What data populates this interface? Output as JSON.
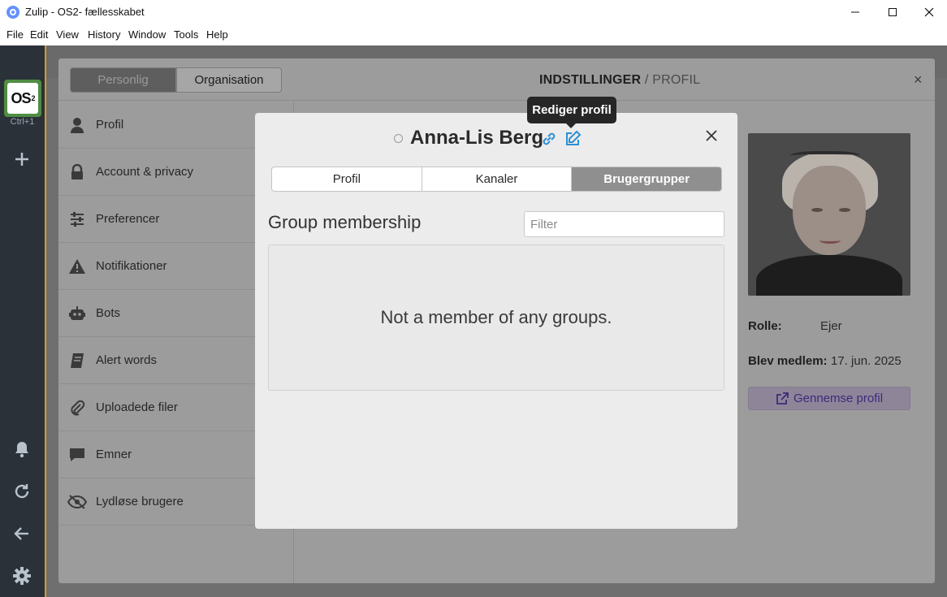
{
  "window": {
    "title": "Zulip - OS2- fællesskabet",
    "menu": [
      "File",
      "Edit",
      "View",
      "History",
      "Window",
      "Tools",
      "Help"
    ]
  },
  "rail": {
    "org_initials": "OS",
    "org_superscript": "2",
    "shortcut": "Ctrl+1"
  },
  "settings": {
    "tab_personal": "Personlig",
    "tab_organization": "Organisation",
    "title_main": "INDSTILLINGER",
    "title_sep": " / ",
    "title_sub": "PROFIL",
    "close": "×",
    "sidebar": [
      {
        "label": "Profil",
        "icon": "user-icon"
      },
      {
        "label": "Account & privacy",
        "icon": "lock-icon"
      },
      {
        "label": "Preferencer",
        "icon": "sliders-icon"
      },
      {
        "label": "Notifikationer",
        "icon": "warning-icon"
      },
      {
        "label": "Bots",
        "icon": "robot-icon"
      },
      {
        "label": "Alert words",
        "icon": "book-icon"
      },
      {
        "label": "Uploadede filer",
        "icon": "paperclip-icon"
      },
      {
        "label": "Emner",
        "icon": "chat-icon"
      },
      {
        "label": "Lydløse brugere",
        "icon": "eye-slash-icon"
      }
    ],
    "profile_info": {
      "role_label": "Rolle:",
      "role_value": "Ejer",
      "joined_label": "Blev medlem:",
      "joined_value": "17. jun. 2025",
      "view_profile": "Gennemse profil"
    }
  },
  "modal": {
    "user_name": "Anna-Lis Berg",
    "tooltip": "Rediger profil",
    "tabs": [
      "Profil",
      "Kanaler",
      "Brugergrupper"
    ],
    "active_tab": "Brugergrupper",
    "section_title": "Group membership",
    "filter_placeholder": "Filter",
    "filter_value": "",
    "empty_message": "Not a member of any groups."
  },
  "colors": {
    "rail_bg": "#2a3139",
    "org_accent": "#d89a22",
    "link_blue": "#2d8fd5",
    "active_tab": "#8f8f8f"
  }
}
